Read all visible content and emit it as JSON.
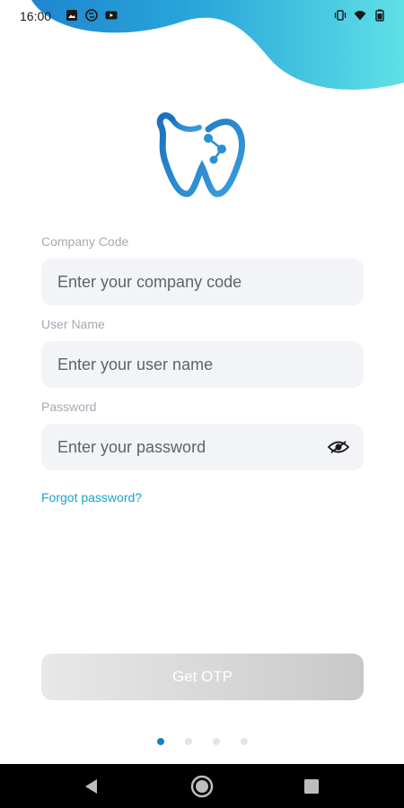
{
  "status_bar": {
    "time": "16:00",
    "left_icons": [
      "image-icon",
      "sync-icon",
      "youtube-icon"
    ],
    "right_icons": [
      "vibrate-icon",
      "wifi-icon",
      "battery-icon"
    ]
  },
  "brand": {
    "logo_icon": "tooth-logo-icon",
    "primary_color": "#1a7fc1",
    "accent_color": "#4fd6e3"
  },
  "form": {
    "company_code": {
      "label": "Company Code",
      "placeholder": "Enter your company code",
      "value": ""
    },
    "user_name": {
      "label": "User Name",
      "placeholder": "Enter your user name",
      "value": ""
    },
    "password": {
      "label": "Password",
      "placeholder": "Enter your password",
      "value": "",
      "toggle_icon": "eye-off-icon"
    },
    "forgot_password": "Forgot password?"
  },
  "actions": {
    "get_otp_label": "Get OTP"
  },
  "pager": {
    "total": 4,
    "active_index": 0
  },
  "nav_bar": {
    "icons": [
      "back-icon",
      "home-icon",
      "recents-icon"
    ]
  }
}
